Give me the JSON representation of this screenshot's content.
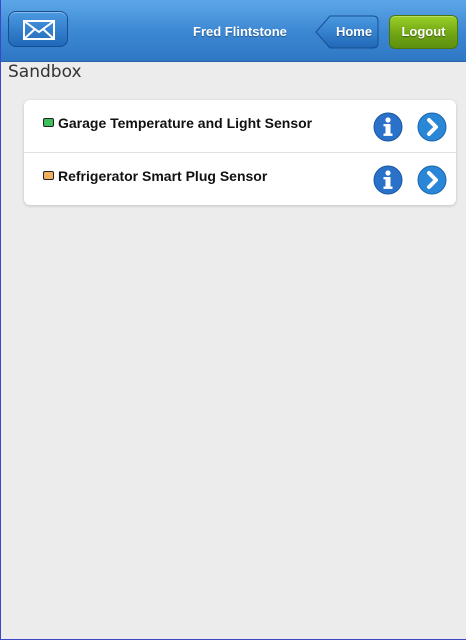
{
  "header": {
    "mail_icon": "envelope-icon",
    "user_name": "Fred Flintstone",
    "home_label": "Home",
    "logout_label": "Logout"
  },
  "page": {
    "title": "Sandbox"
  },
  "colors": {
    "header_blue": "#3b86d2",
    "logout_green": "#6da214",
    "sensor_green": "#3fbf5a",
    "sensor_orange": "#f0b060",
    "icon_blue": "#2a72c9"
  },
  "devices": [
    {
      "label": "Garage Temperature and Light Sensor",
      "status_color": "#3fbf5a"
    },
    {
      "label": "Refrigerator Smart Plug Sensor",
      "status_color": "#f0b060"
    }
  ]
}
